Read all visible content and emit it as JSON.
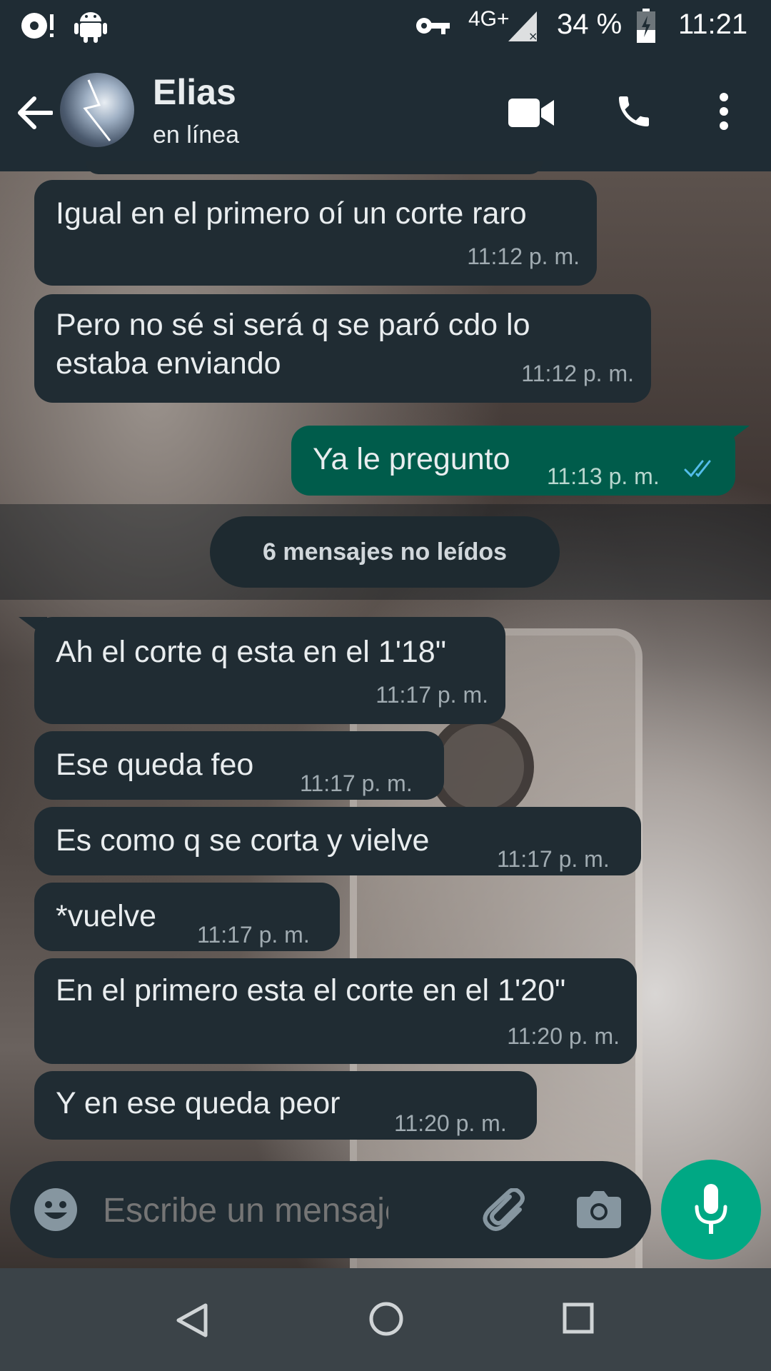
{
  "status_bar": {
    "network": "4G+",
    "battery_percent": "34 %",
    "time": "11:21"
  },
  "contact": {
    "name": "Elias",
    "status": "en línea"
  },
  "messages": [
    {
      "type": "in",
      "text_lines": [
        "Igual en el primero oí un corte raro"
      ],
      "time": "11:12 p. m."
    },
    {
      "type": "in",
      "text_lines": [
        "Pero no sé si será q se paró cdo lo",
        "estaba enviando"
      ],
      "time": "11:12 p. m."
    },
    {
      "type": "out",
      "text_lines": [
        "Ya le pregunto"
      ],
      "time": "11:13 p. m.",
      "read": true
    },
    {
      "type": "in",
      "text_lines": [
        "Ah el corte q esta en el 1'18\""
      ],
      "time": "11:17 p. m."
    },
    {
      "type": "in",
      "text_lines": [
        "Ese queda feo"
      ],
      "time": "11:17 p. m."
    },
    {
      "type": "in",
      "text_lines": [
        "Es como q se corta y vielve"
      ],
      "time": "11:17 p. m."
    },
    {
      "type": "in",
      "text_lines": [
        "*vuelve"
      ],
      "time": "11:17 p. m."
    },
    {
      "type": "in",
      "text_lines": [
        "En el primero esta el corte en el 1'20\""
      ],
      "time": "11:20 p. m."
    },
    {
      "type": "in",
      "text_lines": [
        "Y en ese queda peor"
      ],
      "time": "11:20 p. m."
    }
  ],
  "unread_label": "6 mensajes no leídos",
  "composer": {
    "placeholder": "Escribe un mensaje"
  },
  "colors": {
    "header": "#1f2c34",
    "incoming_bubble": "#202c33",
    "outgoing_bubble": "#005c4b",
    "accent": "#00a884",
    "read_ticks": "#53bdeb"
  },
  "icons": {
    "back": "arrow-left-icon",
    "video": "video-call-icon",
    "call": "phone-icon",
    "menu": "more-vert-icon",
    "emoji": "emoji-icon",
    "attach": "paperclip-icon",
    "camera": "camera-icon",
    "mic": "mic-icon"
  }
}
